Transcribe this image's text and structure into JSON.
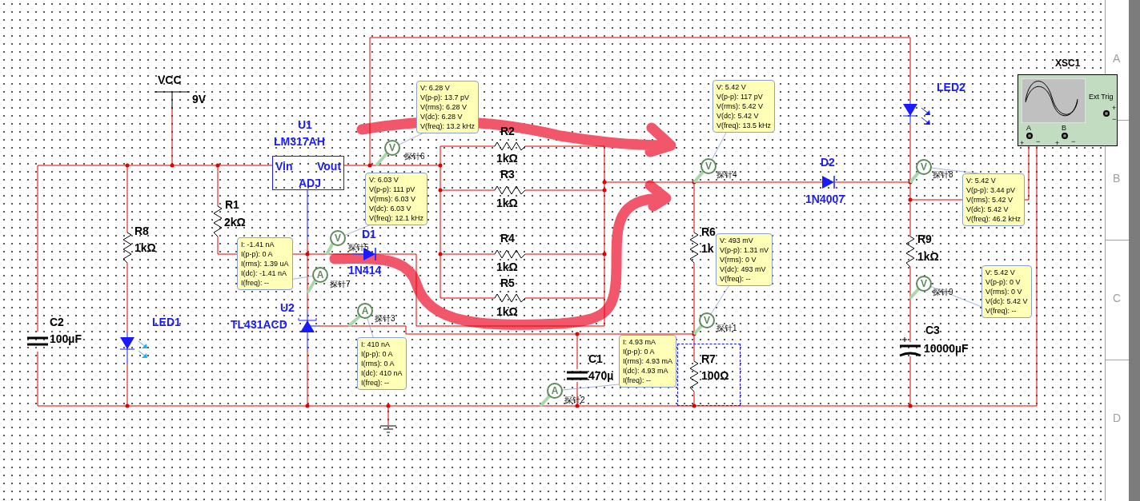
{
  "sheet": {
    "row_labels": [
      "A",
      "B",
      "C",
      "D"
    ]
  },
  "components": [
    {
      "kind": "source",
      "designator": "VCC",
      "value": "9V"
    },
    {
      "kind": "regulator",
      "designator": "U1",
      "value": "LM317AH",
      "pins": [
        "Vin",
        "Vout",
        "ADJ"
      ]
    },
    {
      "kind": "resistor",
      "designator": "R1",
      "value": "2kΩ"
    },
    {
      "kind": "resistor",
      "designator": "R8",
      "value": "1kΩ"
    },
    {
      "kind": "capacitor",
      "designator": "C2",
      "value": "100µF"
    },
    {
      "kind": "led",
      "designator": "LED1"
    },
    {
      "kind": "diode",
      "designator": "D1",
      "value": "1N414"
    },
    {
      "kind": "shunt-regulator",
      "designator": "U2",
      "value": "TL431ACD"
    },
    {
      "kind": "resistor",
      "designator": "R2",
      "value": "1kΩ"
    },
    {
      "kind": "resistor",
      "designator": "R3",
      "value": "1kΩ"
    },
    {
      "kind": "resistor",
      "designator": "R4",
      "value": "1kΩ"
    },
    {
      "kind": "resistor",
      "designator": "R5",
      "value": "1kΩ"
    },
    {
      "kind": "capacitor",
      "designator": "C1",
      "value": "470µ"
    },
    {
      "kind": "resistor",
      "designator": "R6",
      "value": "1k"
    },
    {
      "kind": "resistor",
      "designator": "R7",
      "value": "100Ω",
      "selected": true
    },
    {
      "kind": "diode",
      "designator": "D2",
      "value": "1N4007"
    },
    {
      "kind": "led",
      "designator": "LED2"
    },
    {
      "kind": "resistor",
      "designator": "R9",
      "value": "1kΩ"
    },
    {
      "kind": "polar-capacitor",
      "designator": "C3",
      "value": "10000µF"
    }
  ],
  "probes": [
    {
      "symbol": "V",
      "name": "探针6",
      "readings": [
        "V: 6.28 V",
        "V(p-p): 13.7 pV",
        "V(rms): 6.28 V",
        "V(dc): 6.28 V",
        "V(freq): 13.2 kHz"
      ]
    },
    {
      "symbol": "V",
      "name": "探针5",
      "readings": [
        "V: 6.03 V",
        "V(p-p): 111 pV",
        "V(rms): 6.03 V",
        "V(dc): 6.03 V",
        "V(freq): 12.1 kHz"
      ]
    },
    {
      "symbol": "A",
      "name": "探针7",
      "readings": [
        "I: -1.41 nA",
        "I(p-p): 0 A",
        "I(rms): 1.39 uA",
        "I(dc): -1.41 nA",
        "I(freq): --"
      ]
    },
    {
      "symbol": "A",
      "name": "探针3",
      "readings": [
        "I: 410 nA",
        "I(p-p): 0 A",
        "I(rms): 0 A",
        "I(dc): 410 nA",
        "I(freq): --"
      ]
    },
    {
      "symbol": "V",
      "name": "探针4",
      "readings": [
        "V: 5.42 V",
        "V(p-p): 117 pV",
        "V(rms): 5.42 V",
        "V(dc): 5.42 V",
        "V(freq): 13.5 kHz"
      ]
    },
    {
      "symbol": "V",
      "name": "探针1",
      "readings": [
        "V: 493 mV",
        "V(p-p): 1.31 nV",
        "V(rms): 0 V",
        "V(dc): 493 mV",
        "V(freq): --"
      ]
    },
    {
      "symbol": "A",
      "name": "探针2",
      "readings": [
        "I: 4.93 mA",
        "I(p-p): 0 A",
        "I(rms): 4.93 mA",
        "I(dc): 4.93 mA",
        "I(freq): --"
      ]
    },
    {
      "symbol": "V",
      "name": "探针8",
      "readings": [
        "V: 5.42 V",
        "V(p-p): 3.44 pV",
        "V(rms): 5.42 V",
        "V(dc): 5.42 V",
        "V(freq): 46.2 kHz"
      ]
    },
    {
      "symbol": "V",
      "name": "探针9",
      "readings": [
        "V: 5.42 V",
        "V(p-p): 0 V",
        "V(rms): 0 V",
        "V(dc): 5.42 V",
        "V(freq): --"
      ]
    }
  ],
  "instrument": {
    "designator": "XSC1",
    "trigger_label": "Ext Trig",
    "trigger_marks": [
      "+",
      "−"
    ],
    "channels": [
      {
        "name": "A",
        "marks": [
          "+",
          "−"
        ]
      },
      {
        "name": "B",
        "marks": [
          "+",
          "−"
        ]
      }
    ]
  }
}
